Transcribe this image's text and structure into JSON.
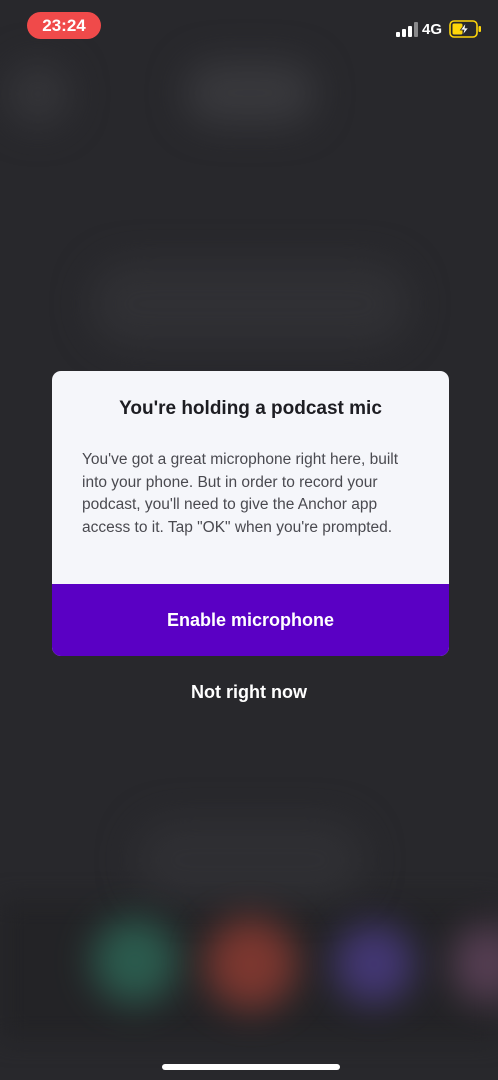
{
  "status_bar": {
    "time": "23:24",
    "network": "4G",
    "icons": {
      "signal": "cellular-signal-icon",
      "battery": "battery-charging-icon"
    }
  },
  "dialog": {
    "title": "You're holding a podcast mic",
    "body": "You've got a great microphone right here, built into your phone. But in order to record your podcast, you'll need to give the Anchor app access to it. Tap \"OK\" when you're prompted.",
    "primary_button": "Enable microphone"
  },
  "secondary_action": "Not right now",
  "colors": {
    "time_pill": "#f04a4a",
    "dialog_background": "#f5f6fa",
    "primary_button": "#5a00c4",
    "battery_fill": "#ffd60a",
    "overlay_background": "#28282c"
  }
}
